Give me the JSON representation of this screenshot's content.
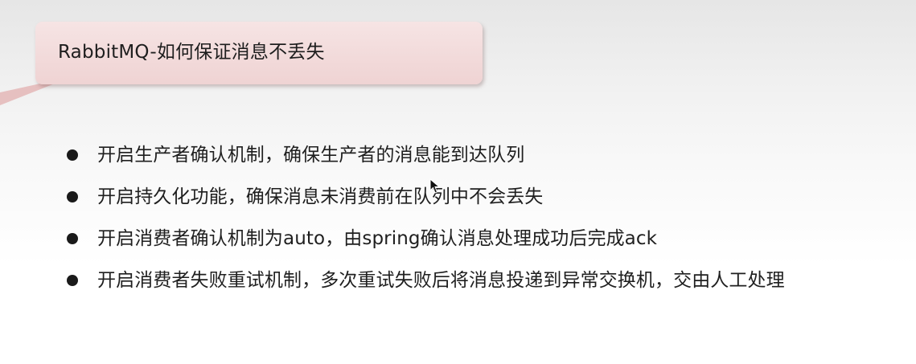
{
  "title": "RabbitMQ-如何保证消息不丢失",
  "bullets": [
    "开启生产者确认机制，确保生产者的消息能到达队列",
    "开启持久化功能，确保消息未消费前在队列中不会丢失",
    "开启消费者确认机制为auto，由spring确认消息处理成功后完成ack",
    "开启消费者失败重试机制，多次重试失败后将消息投递到异常交换机，交由人工处理"
  ],
  "colors": {
    "title_box": "#efd3d3",
    "tail": "#e8c3c3",
    "text": "#1f1f1f"
  }
}
